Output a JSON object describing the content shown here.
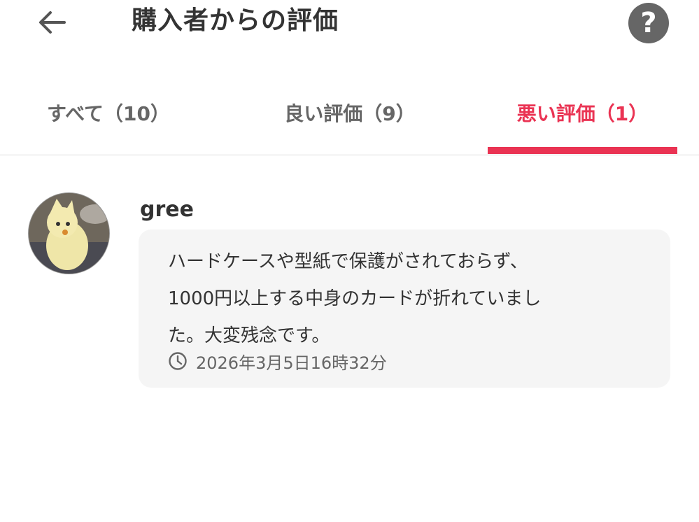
{
  "header": {
    "title": "購入者からの評価",
    "back_icon": "arrow-left-icon",
    "help_icon": "question-icon",
    "help_symbol": "?"
  },
  "tabs": [
    {
      "label": "すべて（10）",
      "active": false
    },
    {
      "label": "良い評価（9）",
      "active": false
    },
    {
      "label": "悪い評価（1）",
      "active": true
    }
  ],
  "review": {
    "username": "gree",
    "comment_lines": [
      "ハードケースや型紙で保護がされておらず、",
      "1000円以上する中身のカードが折れていまし",
      "た。大変残念です。"
    ],
    "time_icon": "clock-icon",
    "timestamp": "2026年3月5日16時32分"
  },
  "colors": {
    "accent": "#ea3353",
    "text": "#333333",
    "muted": "#666666",
    "bubble": "#f5f5f5"
  }
}
